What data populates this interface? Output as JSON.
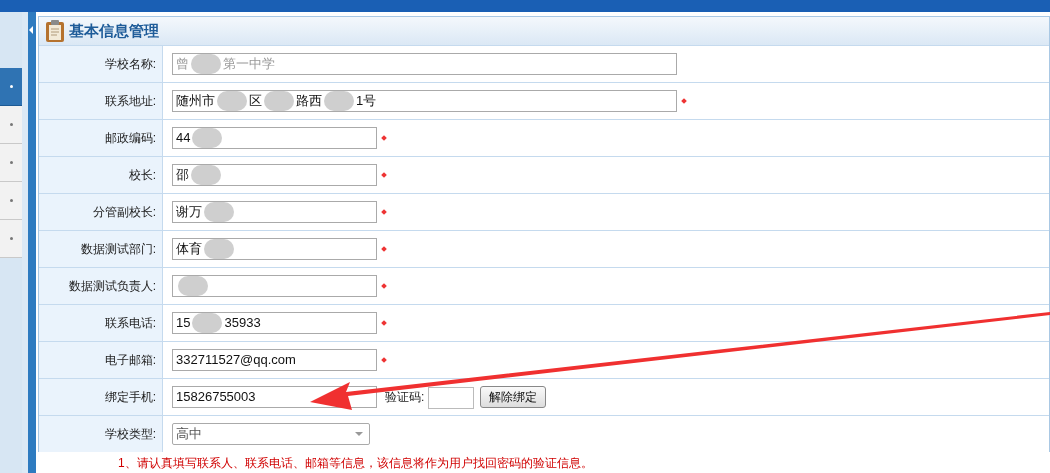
{
  "sidebar": {
    "items": [
      {
        "selected": true
      },
      {
        "selected": false
      },
      {
        "selected": false
      },
      {
        "selected": false
      },
      {
        "selected": false
      }
    ]
  },
  "panel": {
    "title": "基本信息管理"
  },
  "form": {
    "rows": [
      {
        "label": "学校名称:",
        "kind": "input",
        "wide": true,
        "disabled": true,
        "required": false,
        "parts": [
          {
            "kind": "text",
            "text": "曾"
          },
          {
            "kind": "blur"
          },
          {
            "kind": "text",
            "text": "第一中学"
          }
        ]
      },
      {
        "label": "联系地址:",
        "kind": "input",
        "wide": true,
        "disabled": false,
        "required": true,
        "parts": [
          {
            "kind": "text",
            "text": "随州市"
          },
          {
            "kind": "blur"
          },
          {
            "kind": "text",
            "text": "区"
          },
          {
            "kind": "blur"
          },
          {
            "kind": "text",
            "text": "路西"
          },
          {
            "kind": "blur"
          },
          {
            "kind": "text",
            "text": "1号"
          }
        ]
      },
      {
        "label": "邮政编码:",
        "kind": "input",
        "wide": false,
        "disabled": false,
        "required": true,
        "parts": [
          {
            "kind": "text",
            "text": "44"
          },
          {
            "kind": "blur"
          }
        ]
      },
      {
        "label": "校长:",
        "kind": "input",
        "wide": false,
        "disabled": false,
        "required": true,
        "parts": [
          {
            "kind": "text",
            "text": "邵"
          },
          {
            "kind": "blur"
          }
        ]
      },
      {
        "label": "分管副校长:",
        "kind": "input",
        "wide": false,
        "disabled": false,
        "required": true,
        "parts": [
          {
            "kind": "text",
            "text": "谢万"
          },
          {
            "kind": "blur"
          }
        ]
      },
      {
        "label": "数据测试部门:",
        "kind": "input",
        "wide": false,
        "disabled": false,
        "required": true,
        "parts": [
          {
            "kind": "text",
            "text": "体育"
          },
          {
            "kind": "blur"
          }
        ]
      },
      {
        "label": "数据测试负责人:",
        "kind": "input",
        "wide": false,
        "disabled": false,
        "required": true,
        "parts": [
          {
            "kind": "blur"
          }
        ]
      },
      {
        "label": "联系电话:",
        "kind": "input",
        "wide": false,
        "disabled": false,
        "required": true,
        "parts": [
          {
            "kind": "text",
            "text": "15"
          },
          {
            "kind": "blur"
          },
          {
            "kind": "text",
            "text": "35933"
          }
        ]
      },
      {
        "label": "电子邮箱:",
        "kind": "input",
        "wide": false,
        "disabled": false,
        "required": true,
        "parts": [
          {
            "kind": "text",
            "text": "332711527@qq.com"
          }
        ]
      },
      {
        "label": "绑定手机:",
        "kind": "phone",
        "wide": false,
        "disabled": false,
        "required": false,
        "parts": [
          {
            "kind": "text",
            "text": "15826755003"
          }
        ],
        "code_label": "验证码:",
        "button": "解除绑定"
      },
      {
        "label": "学校类型:",
        "kind": "select",
        "wide": false,
        "disabled": false,
        "required": false,
        "parts": [
          {
            "kind": "text",
            "text": "高中"
          }
        ]
      }
    ]
  },
  "note": "1、请认真填写联系人、联系电话、邮箱等信息，该信息将作为用户找回密码的验证信息。",
  "annotation": {
    "kind": "arrow"
  }
}
